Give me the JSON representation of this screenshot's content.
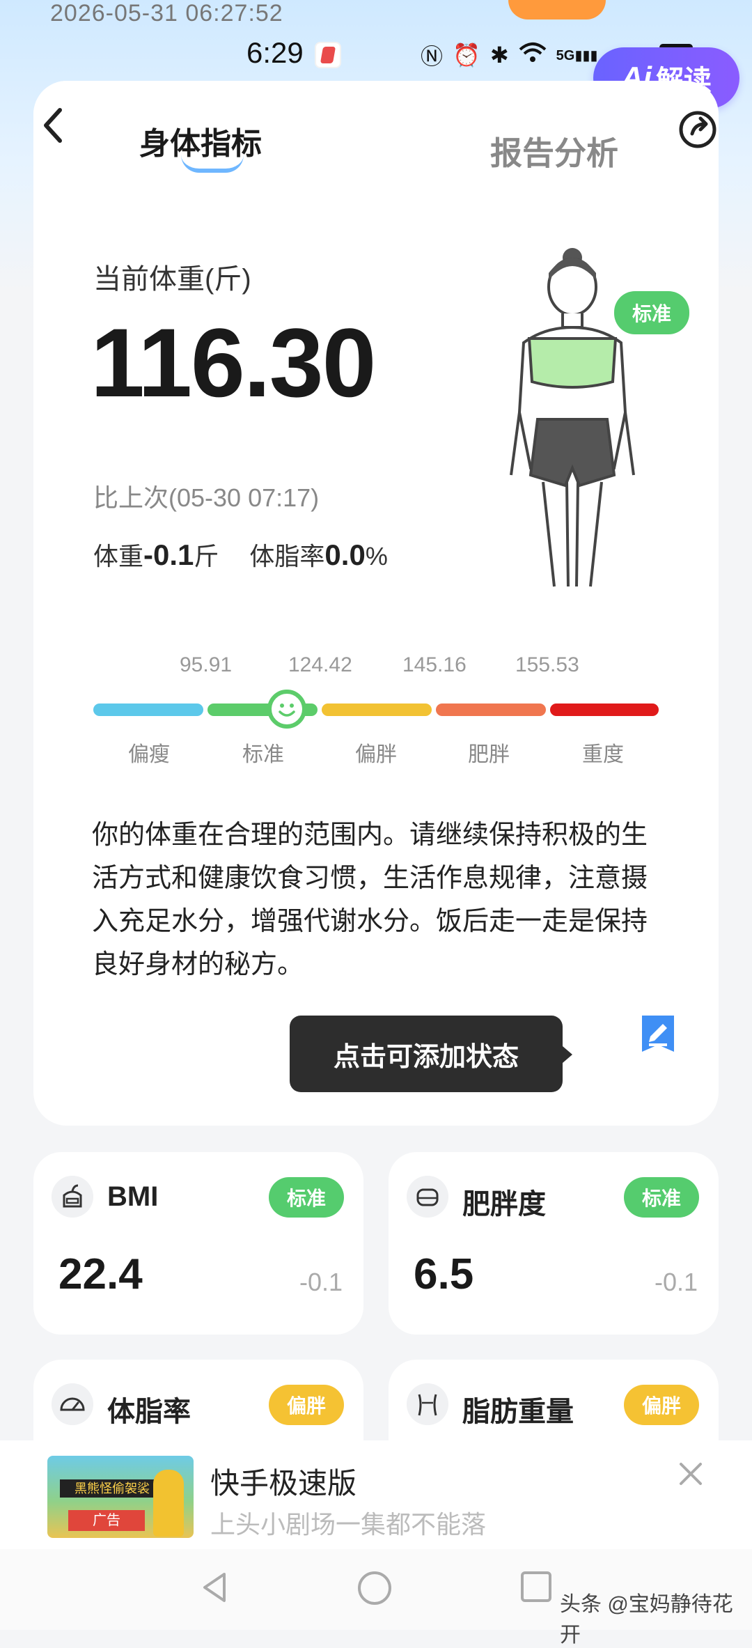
{
  "status_bar": {
    "timestamp": "2026-05-31 06:27:52",
    "time": "6:29",
    "icons": [
      "nfc-icon",
      "alarm-icon",
      "bluetooth-icon",
      "wifi-icon",
      "5g-signal-icon",
      "4g-signal-icon",
      "battery-icon"
    ]
  },
  "header": {
    "tab_body": "身体指标",
    "tab_report": "报告分析",
    "ai_button": "解读",
    "ai_logo": "Ai"
  },
  "weight": {
    "label": "当前体重(斤)",
    "value": "116.30",
    "compare_label": "比上次(05-30 07:17)",
    "weight_label": "体重",
    "weight_delta": "-0.1",
    "weight_unit": "斤",
    "fat_label": "体脂率",
    "fat_delta": "0.0",
    "fat_unit": "%",
    "status_badge": "标准"
  },
  "scale": {
    "thresholds": [
      "95.91",
      "124.42",
      "145.16",
      "155.53"
    ],
    "segments": [
      {
        "label": "偏瘦",
        "color": "#5cc8ea"
      },
      {
        "label": "标准",
        "color": "#5ccc6a"
      },
      {
        "label": "偏胖",
        "color": "#f2c233"
      },
      {
        "label": "肥胖",
        "color": "#f0764f"
      },
      {
        "label": "重度",
        "color": "#e01a1a"
      }
    ],
    "current_segment": "标准"
  },
  "advice": {
    "text": "你的体重在合理的范围内。请继续保持积极的生活方式和健康饮食习惯，生活作息规律，注意摄入充足水分，增强代谢水分。饭后走一走是保持良好身材的秘方。"
  },
  "tooltip": {
    "text": "点击可添加状态"
  },
  "metrics": [
    {
      "title": "BMI",
      "badge": "标准",
      "value": "22.4",
      "delta": "-0.1"
    },
    {
      "title": "肥胖度",
      "badge": "标准",
      "value": "6.5",
      "delta": "-0.1"
    },
    {
      "title": "体脂率",
      "badge": "偏胖"
    },
    {
      "title": "脂肪重量",
      "badge": "偏胖"
    }
  ],
  "ad": {
    "title": "快手极速版",
    "subtitle": "上头小剧场一集都不能落",
    "thumb_banner": "黑熊怪偷袈裟",
    "thumb_tag": "广告"
  },
  "watermark": "头条 @宝妈静待花开",
  "colors": {
    "green": "#55cc6e",
    "yellow": "#f5c233",
    "ai_purple": "#6a63ff"
  }
}
